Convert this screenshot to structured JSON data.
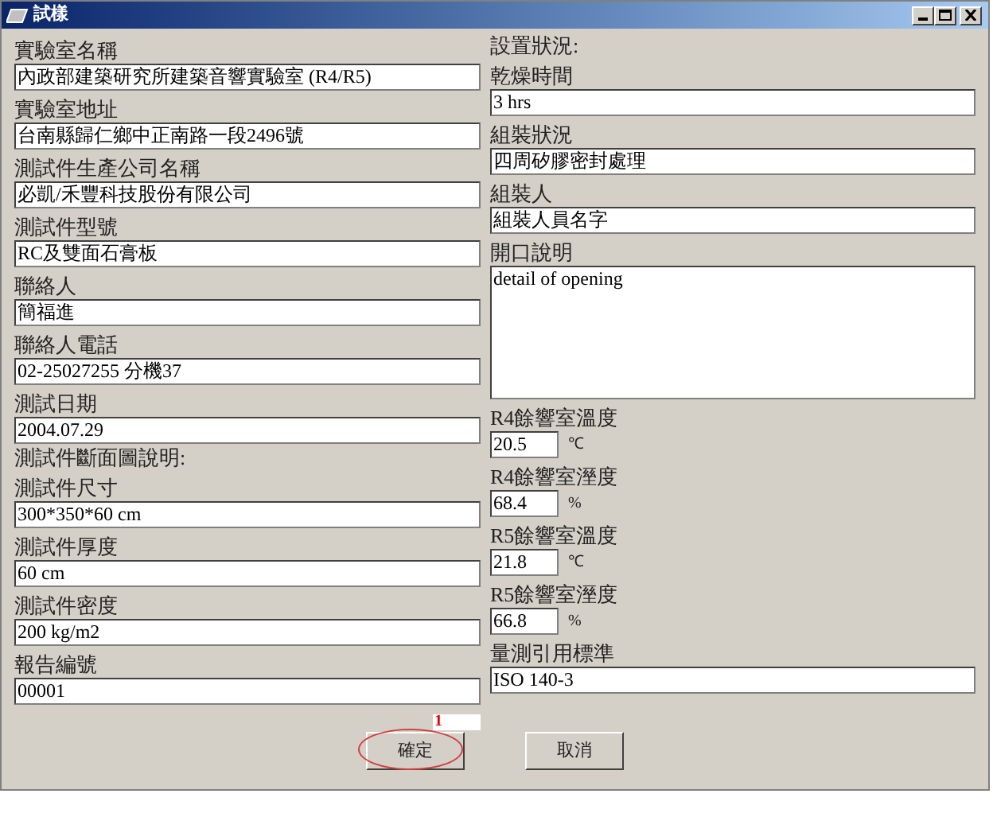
{
  "window": {
    "title": "試樣"
  },
  "left": [
    {
      "kind": "field",
      "label": "實驗室名稱",
      "value": "內政部建築研究所建築音響實驗室 (R4/R5)"
    },
    {
      "kind": "field",
      "label": "實驗室地址",
      "value": "台南縣歸仁鄉中正南路一段2496號"
    },
    {
      "kind": "field",
      "label": "測試件生產公司名稱",
      "value": "必凱/禾豐科技股份有限公司"
    },
    {
      "kind": "field",
      "label": "測試件型號",
      "value": "RC及雙面石膏板"
    },
    {
      "kind": "field",
      "label": "聯絡人",
      "value": "簡福進"
    },
    {
      "kind": "field",
      "label": "聯絡人電話",
      "value": "02-25027255 分機37"
    },
    {
      "kind": "field",
      "label": "測試日期",
      "value": "2004.07.29"
    },
    {
      "kind": "heading",
      "label": "測試件斷面圖說明:"
    },
    {
      "kind": "field",
      "label": "測試件尺寸",
      "value": "300*350*60 cm"
    },
    {
      "kind": "field",
      "label": "測試件厚度",
      "value": "60 cm"
    },
    {
      "kind": "field",
      "label": "測試件密度",
      "value": "200 kg/m2"
    },
    {
      "kind": "field",
      "label": "報告編號",
      "value": "00001"
    }
  ],
  "right": [
    {
      "kind": "heading",
      "label": "設置狀況:"
    },
    {
      "kind": "field",
      "label": "乾燥時間",
      "value": "3 hrs"
    },
    {
      "kind": "field",
      "label": "組裝狀況",
      "value": "四周矽膠密封處理"
    },
    {
      "kind": "field",
      "label": "組裝人",
      "value": "組裝人員名字"
    },
    {
      "kind": "textarea",
      "label": "開口說明",
      "value": "detail of opening"
    },
    {
      "kind": "measure",
      "label": "R4餘響室溫度",
      "value": "20.5",
      "unit": "℃"
    },
    {
      "kind": "measure",
      "label": "R4餘響室溼度",
      "value": "68.4",
      "unit": "%"
    },
    {
      "kind": "measure",
      "label": "R5餘響室溫度",
      "value": "21.8",
      "unit": "℃"
    },
    {
      "kind": "measure",
      "label": "R5餘響室溼度",
      "value": "66.8",
      "unit": "%"
    },
    {
      "kind": "field",
      "label": "量測引用標準",
      "value": "ISO 140-3"
    }
  ],
  "buttons": [
    {
      "label": "確定",
      "annotation": "1"
    },
    {
      "label": "取消"
    }
  ]
}
